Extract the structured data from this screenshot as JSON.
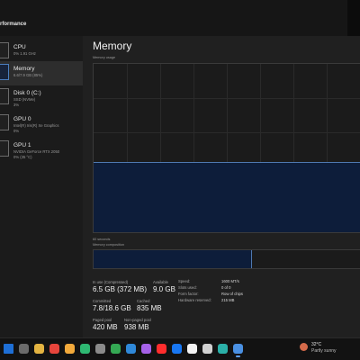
{
  "app": {
    "section_title": "rformance"
  },
  "sidebar": {
    "items": [
      {
        "name": "CPU",
        "sub": "0%  1.91 GHz",
        "sub2": ""
      },
      {
        "name": "Memory",
        "sub": "6.6/7.9 GB (85%)",
        "sub2": ""
      },
      {
        "name": "Disk 0 (C:)",
        "sub": "SSD (NVMe)",
        "sub2": "3%"
      },
      {
        "name": "GPU 0",
        "sub": "Intel(R) Iris(R) Xe Graphics",
        "sub2": "0%"
      },
      {
        "name": "GPU 1",
        "sub": "NVIDIA GeForce RTX 2050",
        "sub2": "0% (35 °C)"
      }
    ]
  },
  "main": {
    "title": "Memory",
    "usage_label": "Memory usage",
    "duration_label": "60 seconds",
    "composition_label": "Memory composition",
    "usage_fraction": 0.41,
    "composition_inuse_fraction": 0.59
  },
  "stats": {
    "in_use_label": "In use (Compressed)",
    "in_use_value": "6.5 GB (372 MB)",
    "available_label": "Available",
    "available_value": "9.0 GB",
    "committed_label": "Committed",
    "committed_value": "7.8/18.6 GB",
    "cached_label": "Cached",
    "cached_value": "835 MB",
    "paged_label": "Paged pool",
    "paged_value": "420 MB",
    "nonpaged_label": "Non-paged pool",
    "nonpaged_value": "938 MB"
  },
  "specs": [
    {
      "label": "Speed:",
      "value": "1600 MT/s"
    },
    {
      "label": "Slots used:",
      "value": "0 of 0"
    },
    {
      "label": "Form factor:",
      "value": "Row of chips"
    },
    {
      "label": "Hardware reserved:",
      "value": "215 MB"
    }
  ],
  "taskbar": {
    "weather_temp": "32°C",
    "weather_desc": "Partly sunny",
    "icons": [
      {
        "name": "start-icon",
        "color": "#1e6fd6"
      },
      {
        "name": "search-icon",
        "color": "#6b6b6b"
      },
      {
        "name": "file-explorer-icon",
        "color": "#e3b341"
      },
      {
        "name": "chrome-icon",
        "color": "#e8453c"
      },
      {
        "name": "app-icon-1",
        "color": "#f2a93b"
      },
      {
        "name": "app-icon-2",
        "color": "#2eb872"
      },
      {
        "name": "settings-icon",
        "color": "#8a8a8a"
      },
      {
        "name": "chrome-icon-2",
        "color": "#34a853"
      },
      {
        "name": "vscode-icon",
        "color": "#2f88d8"
      },
      {
        "name": "messenger-icon",
        "color": "#a561e8"
      },
      {
        "name": "youtube-icon",
        "color": "#ff2d2d"
      },
      {
        "name": "facebook-icon",
        "color": "#1877f2"
      },
      {
        "name": "tiktok-icon",
        "color": "#f2f2f2"
      },
      {
        "name": "chatgpt-icon",
        "color": "#d0d0d0"
      },
      {
        "name": "edge-icon",
        "color": "#2bb0a8"
      },
      {
        "name": "task-manager-icon",
        "color": "#4a90e2"
      }
    ]
  }
}
